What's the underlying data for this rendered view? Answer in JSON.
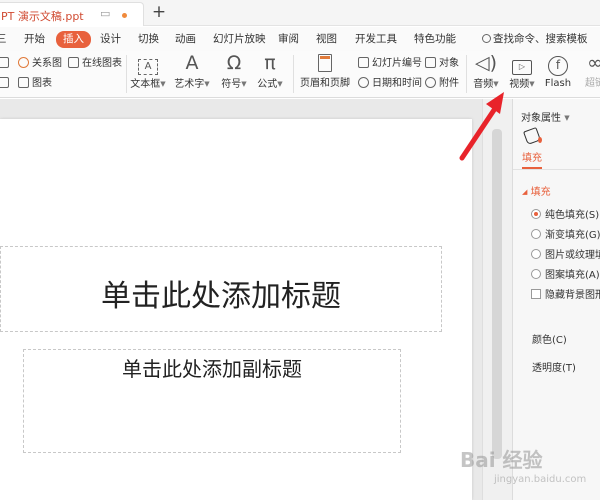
{
  "titlebar": {
    "doc_title": "PT 演示文稿.ppt",
    "new_tab": "+"
  },
  "ribbon_tabs": [
    "开始",
    "插入",
    "设计",
    "切换",
    "动画",
    "幻灯片放映",
    "审阅",
    "视图",
    "开发工具",
    "特色功能"
  ],
  "active_tab": "插入",
  "search": {
    "label": "查找命令、搜索模板"
  },
  "ribbon": {
    "relation_graph": "关系图",
    "online_chart": "在线图表",
    "chart": "图表",
    "textbox": "文本框",
    "art_text": "艺术字",
    "symbol": "符号",
    "formula": "公式",
    "header_footer": "页眉和页脚",
    "slide_number": "幻灯片编号",
    "object": "对象",
    "date_time": "日期和时间",
    "attachment": "附件",
    "audio": "音频",
    "video": "视频",
    "flash": "Flash",
    "hyperlink_partial": "超链"
  },
  "slide": {
    "title_placeholder": "单击此处添加标题",
    "subtitle_placeholder": "单击此处添加副标题"
  },
  "pane": {
    "title": "对象属性",
    "tab": "填充",
    "section": "填充",
    "options": [
      "纯色填充(S)",
      "渐变填充(G)",
      "图片或纹理填",
      "图案填充(A)"
    ],
    "selected_option": "纯色填充(S)",
    "hide_bg": "隐藏背景图形",
    "color_label": "颜色(C)",
    "transparency_label": "透明度(T)"
  },
  "watermark": {
    "text": "Bai 经验",
    "sub": "jingyan.baidu.com"
  },
  "colors": {
    "accent": "#e8613d",
    "arrow": "#e8232a"
  }
}
